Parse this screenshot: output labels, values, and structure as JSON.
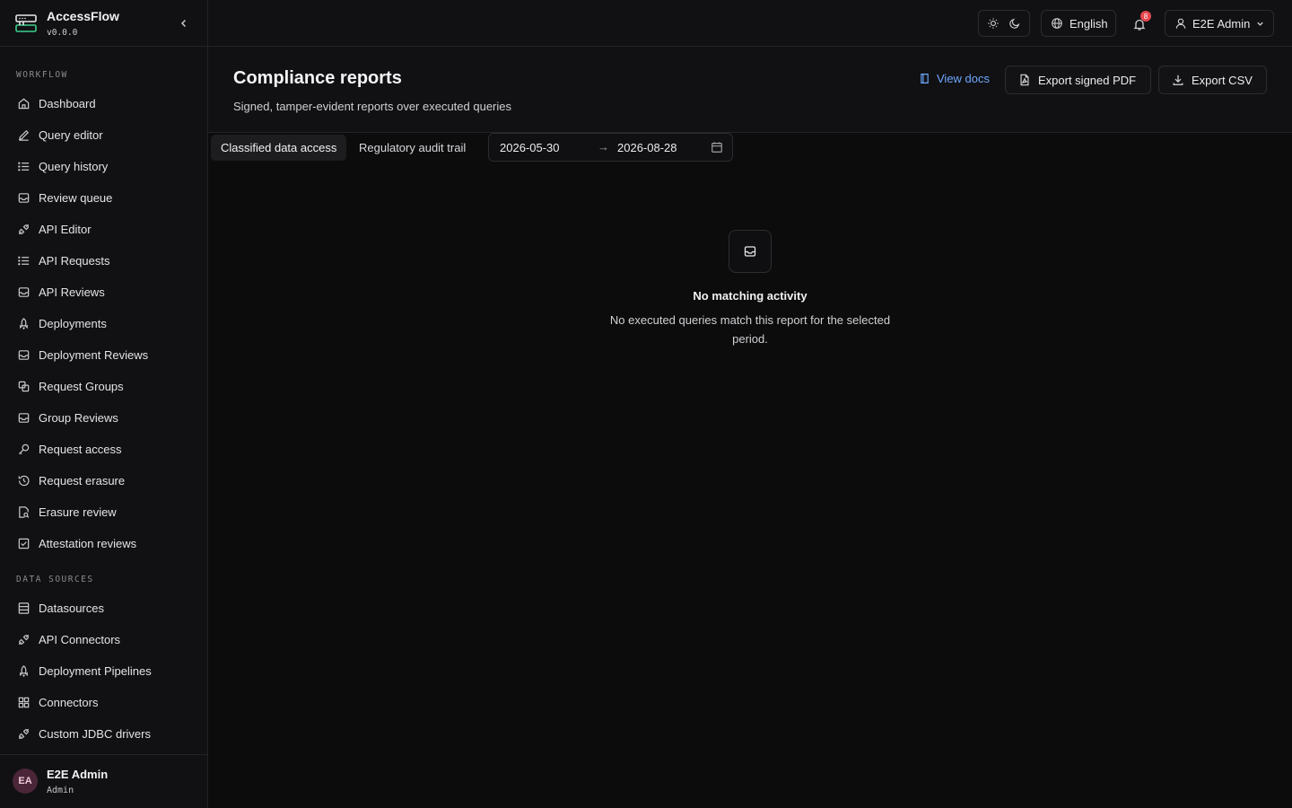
{
  "app": {
    "name": "AccessFlow",
    "version": "v0.0.0"
  },
  "sidebar": {
    "sections": [
      {
        "label": "WORKFLOW",
        "items": [
          {
            "label": "Dashboard",
            "icon": "home-icon"
          },
          {
            "label": "Query editor",
            "icon": "pencil-icon"
          },
          {
            "label": "Query history",
            "icon": "list-icon"
          },
          {
            "label": "Review queue",
            "icon": "inbox-icon"
          },
          {
            "label": "API Editor",
            "icon": "plug-icon"
          },
          {
            "label": "API Requests",
            "icon": "list-icon"
          },
          {
            "label": "API Reviews",
            "icon": "inbox-icon"
          },
          {
            "label": "Deployments",
            "icon": "rocket-icon"
          },
          {
            "label": "Deployment Reviews",
            "icon": "inbox-icon"
          },
          {
            "label": "Request Groups",
            "icon": "copy-icon"
          },
          {
            "label": "Group Reviews",
            "icon": "inbox-icon"
          },
          {
            "label": "Request access",
            "icon": "key-icon"
          },
          {
            "label": "Request erasure",
            "icon": "history-icon"
          },
          {
            "label": "Erasure review",
            "icon": "file-search-icon"
          },
          {
            "label": "Attestation reviews",
            "icon": "check-square-icon"
          }
        ]
      },
      {
        "label": "DATA SOURCES",
        "items": [
          {
            "label": "Datasources",
            "icon": "database-icon"
          },
          {
            "label": "API Connectors",
            "icon": "plug-icon"
          },
          {
            "label": "Deployment Pipelines",
            "icon": "rocket-icon"
          },
          {
            "label": "Connectors",
            "icon": "grid-icon"
          },
          {
            "label": "Custom JDBC drivers",
            "icon": "plug-icon"
          }
        ]
      }
    ],
    "user": {
      "initials": "EA",
      "name": "E2E Admin",
      "role": "Admin"
    }
  },
  "topbar": {
    "language": "English",
    "notifications_count": "8",
    "user_name": "E2E Admin"
  },
  "page": {
    "title": "Compliance reports",
    "subtitle": "Signed, tamper-evident reports over executed queries",
    "view_docs": "View docs",
    "export_pdf": "Export signed PDF",
    "export_csv": "Export CSV"
  },
  "tabs": [
    {
      "label": "Classified data access",
      "active": true
    },
    {
      "label": "Regulatory audit trail",
      "active": false
    }
  ],
  "date_range": {
    "start": "2026-05-30",
    "arrow": "→",
    "end": "2026-08-28"
  },
  "empty_state": {
    "title": "No matching activity",
    "description": "No executed queries match this report for the selected period."
  },
  "colors": {
    "accent_link": "#6ea8ff",
    "badge": "#e5484d",
    "background": "#0c0c0d",
    "panel": "#111113"
  }
}
